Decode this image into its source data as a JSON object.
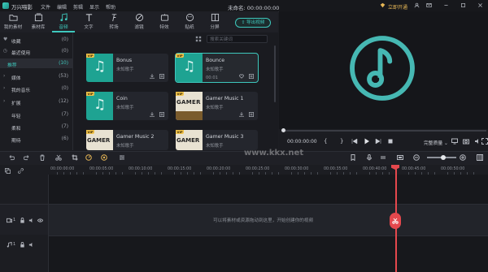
{
  "app": {
    "name": "万兴喵影",
    "menu": [
      "文件",
      "编辑",
      "剪辑",
      "显示",
      "帮助"
    ],
    "window_title": "未命名: 00:00:00:00",
    "vip_label": "立即开通"
  },
  "toolbar": {
    "items": [
      {
        "label": "我的素材",
        "icon": "folder-icon"
      },
      {
        "label": "素材库",
        "icon": "media-library-icon"
      },
      {
        "label": "音频",
        "icon": "music-note-icon",
        "active": true
      },
      {
        "label": "文字",
        "icon": "text-icon"
      },
      {
        "label": "转场",
        "icon": "transition-icon"
      },
      {
        "label": "滤镜",
        "icon": "filter-icon"
      },
      {
        "label": "特效",
        "icon": "effects-icon"
      },
      {
        "label": "贴纸",
        "icon": "sticker-icon"
      },
      {
        "label": "分屏",
        "icon": "split-screen-icon"
      }
    ],
    "export_label": "导出视频"
  },
  "sidebar": {
    "items": [
      {
        "label": "收藏",
        "count": "(0)",
        "icon": "heart-icon"
      },
      {
        "label": "最近使用",
        "count": "(0)",
        "icon": "clock-icon"
      },
      {
        "label": "推荐",
        "count": "(10)",
        "selected": true
      },
      {
        "label": "媒体",
        "count": "(53)",
        "expand": true
      },
      {
        "label": "我的音乐",
        "count": "(0)",
        "expand": true
      },
      {
        "label": "扩展",
        "count": "(12)",
        "expand": true
      },
      {
        "label": "年轻",
        "count": "(7)"
      },
      {
        "label": "柔和",
        "count": "(7)"
      },
      {
        "label": "期待",
        "count": "(6)"
      }
    ]
  },
  "search": {
    "placeholder": "搜索关键词"
  },
  "cards": [
    {
      "title": "Bonus",
      "subtitle": "未知歌手",
      "tag": "VIP",
      "thumb": "note"
    },
    {
      "title": "Bounce",
      "subtitle": "未知歌手",
      "tag": "VIP",
      "thumb": "note",
      "selected": true,
      "duration": "00:01"
    },
    {
      "title": "Coin",
      "subtitle": "未知歌手",
      "tag": "VIP",
      "thumb": "note"
    },
    {
      "title": "Gamer Music 1",
      "subtitle": "未知歌手",
      "tag": "VIP",
      "thumb": "game"
    },
    {
      "title": "Gamer Music 2",
      "subtitle": "未知歌手",
      "tag": "VIP",
      "thumb": "game"
    },
    {
      "title": "Gamer Music 3",
      "subtitle": "未知歌手",
      "tag": "VIP",
      "thumb": "game"
    }
  ],
  "game_thumb_text": "GAMER",
  "preview": {
    "timecode": "00:00:00:00",
    "quality": "完整质量",
    "progress": 0
  },
  "timeline": {
    "ruler": [
      "00:00:00:00",
      "00:00:05:00",
      "00:00:10:00",
      "00:00:15:00",
      "00:00:20:00",
      "00:00:25:00",
      "00:00:30:00",
      "00:00:35:00",
      "00:00:40:00",
      "00:00:45:00",
      "00:00:50:00"
    ],
    "hint": "可以将素材或资源拖动到这里，开始创建你的视频",
    "track_video_num": "1",
    "track_audio_num": "1"
  },
  "watermark": "www.kkx.net",
  "colors": {
    "accent": "#3ec8bd",
    "playhead": "#e5484d",
    "vip": "#f0c24b"
  }
}
